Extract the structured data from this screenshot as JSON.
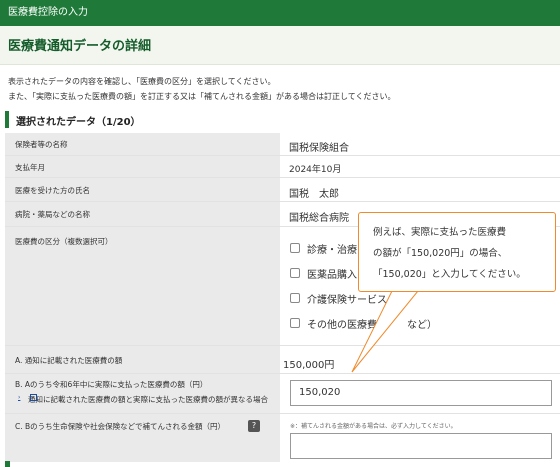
{
  "header": {
    "top_title": "医療費控除の入力",
    "page_title": "医療費通知データの詳細"
  },
  "instructions": {
    "line1": "表示されたデータの内容を確認し、「医療費の区分」を選択してください。",
    "line2": "また、「実際に支払った医療費の額」を訂正する又は「補てんされる金額」がある場合は訂正してください。"
  },
  "section": {
    "title": "選択されたデータ（1/20）"
  },
  "fields": {
    "insurer": {
      "label": "保険者等の名称",
      "value": "国税保険組合"
    },
    "month": {
      "label": "支払年月",
      "value": "2024年10月"
    },
    "patient": {
      "label": "医療を受けた方の氏名",
      "value": "国税　太郎"
    },
    "hospital": {
      "label": "病院・薬局などの名称",
      "value": "国税総合病院"
    },
    "category": {
      "label": "医療費の区分（複数選択可）",
      "options": [
        "診療・治療",
        "医薬品購入",
        "介護保険サービス",
        "その他の医療費（　　など）"
      ]
    },
    "notified": {
      "label": "A. 通知に記載された医療費の額",
      "value": "150,000円"
    },
    "paid": {
      "label": "B. Aのうち令和6年中に実際に支払った医療費の額（円）",
      "link": "通知に記載された医療費の額と実際に支払った医療費の額が異なる場合",
      "input_value": "150,020"
    },
    "reimbursed": {
      "label": "C. Bのうち生命保険や社会保険などで補てんされる金額（円）",
      "help": "?",
      "note": "※：補てんされる金額がある場合は、必ず入力してください。",
      "input_value": ""
    }
  },
  "tooltip": {
    "line1": "例えば、実際に支払った医療費",
    "line2": "の額が「150,020円」の場合、",
    "line3": "「150,020」と入力してください。"
  },
  "colors": {
    "brand_green": "#1f7a3a",
    "callout_border": "#f08a2a",
    "label_bg": "#eaeaea"
  }
}
